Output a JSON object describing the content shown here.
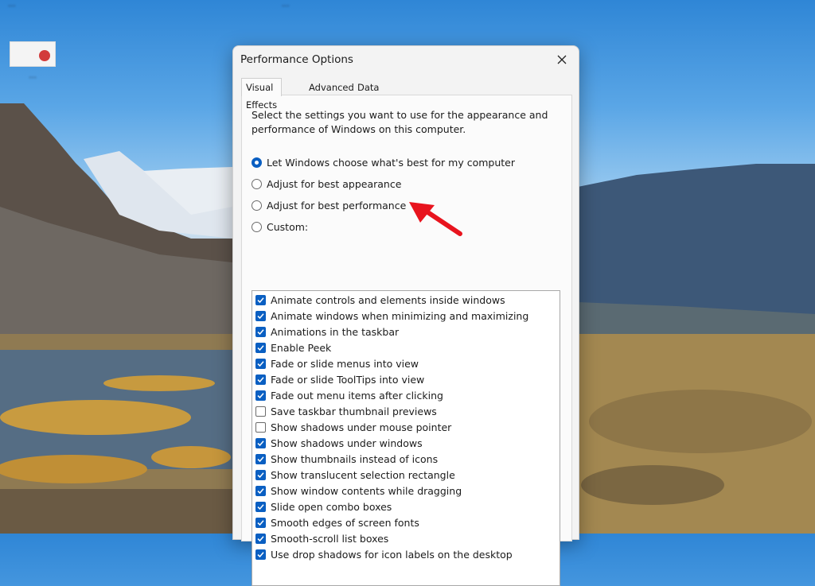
{
  "desktop": {
    "top_label_left": "...",
    "top_label_center": "...",
    "icon_label": "..."
  },
  "dialog": {
    "title": "Performance Options",
    "close_icon": "close-icon",
    "tabs": [
      {
        "label": "Visual Effects",
        "active": true
      },
      {
        "label": "Advanced",
        "active": false
      },
      {
        "label": "Data Execution Prevention",
        "active": false
      }
    ],
    "description": "Select the settings you want to use for the appearance and performance of Windows on this computer.",
    "radios": [
      {
        "label": "Let Windows choose what's best for my computer",
        "selected": true
      },
      {
        "label": "Adjust for best appearance",
        "selected": false
      },
      {
        "label": "Adjust for best performance",
        "selected": false
      },
      {
        "label": "Custom:",
        "selected": false
      }
    ],
    "options": [
      {
        "label": "Animate controls and elements inside windows",
        "checked": true
      },
      {
        "label": "Animate windows when minimizing and maximizing",
        "checked": true
      },
      {
        "label": "Animations in the taskbar",
        "checked": true
      },
      {
        "label": "Enable Peek",
        "checked": true
      },
      {
        "label": "Fade or slide menus into view",
        "checked": true
      },
      {
        "label": "Fade or slide ToolTips into view",
        "checked": true
      },
      {
        "label": "Fade out menu items after clicking",
        "checked": true
      },
      {
        "label": "Save taskbar thumbnail previews",
        "checked": false
      },
      {
        "label": "Show shadows under mouse pointer",
        "checked": false
      },
      {
        "label": "Show shadows under windows",
        "checked": true
      },
      {
        "label": "Show thumbnails instead of icons",
        "checked": true
      },
      {
        "label": "Show translucent selection rectangle",
        "checked": true
      },
      {
        "label": "Show window contents while dragging",
        "checked": true
      },
      {
        "label": "Slide open combo boxes",
        "checked": true
      },
      {
        "label": "Smooth edges of screen fonts",
        "checked": true
      },
      {
        "label": "Smooth-scroll list boxes",
        "checked": true
      },
      {
        "label": "Use drop shadows for icon labels on the desktop",
        "checked": true
      }
    ]
  },
  "colors": {
    "accent": "#0a5fc2",
    "annotation": "#e8141e"
  }
}
